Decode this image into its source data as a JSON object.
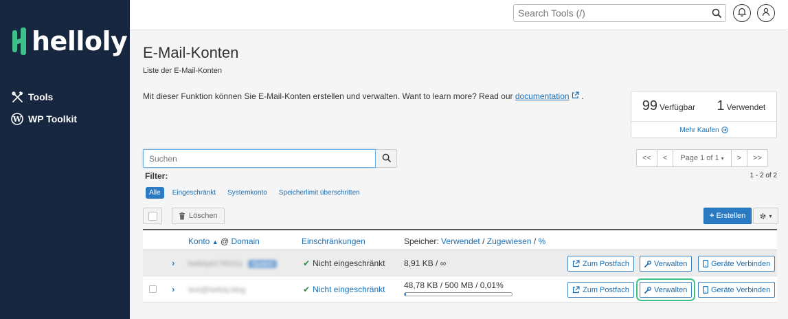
{
  "brand": {
    "name": "helloly",
    "accent": "#3fbf8a",
    "sidebar_bg": "#17273f"
  },
  "sidebar": {
    "items": [
      {
        "label": "Tools",
        "icon": "tools-icon"
      },
      {
        "label": "WP Toolkit",
        "icon": "wordpress-icon"
      }
    ]
  },
  "topbar": {
    "search_placeholder": "Search Tools (/)"
  },
  "page": {
    "title": "E-Mail-Konten",
    "subtitle": "Liste der E-Mail-Konten",
    "intro_text": "Mit dieser Funktion können Sie E-Mail-Konten erstellen und verwalten. Want to learn more? Read our ",
    "intro_link": "documentation",
    "intro_end": " ."
  },
  "stats": {
    "available_count": "99",
    "available_label": "Verfügbar",
    "used_count": "1",
    "used_label": "Verwendet",
    "buy_more": "Mehr Kaufen"
  },
  "search": {
    "placeholder": "Suchen"
  },
  "pagination": {
    "first": "<<",
    "prev": "<",
    "page_label": "Page 1 of 1",
    "next": ">",
    "last": ">>",
    "count": "1 - 2 of 2"
  },
  "filters": {
    "label": "Filter:",
    "items": [
      "Alle",
      "Eingeschränkt",
      "Systemkonto",
      "Speicherlimit überschritten"
    ],
    "active": "Alle"
  },
  "toolbar": {
    "delete_label": "Löschen",
    "create_label": "Erstellen"
  },
  "table": {
    "headers": {
      "konto": "Konto",
      "at": "@",
      "domain": "Domain",
      "restrictions": "Einschränkungen",
      "storage_prefix": "Speicher:",
      "used": "Verwendet",
      "sep1": "/",
      "assigned": "Zugewiesen",
      "sep2": "/",
      "percent": "%"
    },
    "rows": [
      {
        "account": "helloly61765311",
        "tag": "System",
        "restriction": "Nicht eingeschränkt",
        "storage": "8,91 KB / ∞",
        "actions": [
          "Zum Postfach",
          "Verwalten",
          "Geräte Verbinden"
        ]
      },
      {
        "account": "test@helloly.blog",
        "restriction": "Nicht eingeschränkt",
        "storage": "48,78 KB / 500 MB / 0,01%",
        "usage_fraction": 0.01,
        "actions": [
          "Zum Postfach",
          "Verwalten",
          "Geräte Verbinden"
        ]
      }
    ]
  }
}
